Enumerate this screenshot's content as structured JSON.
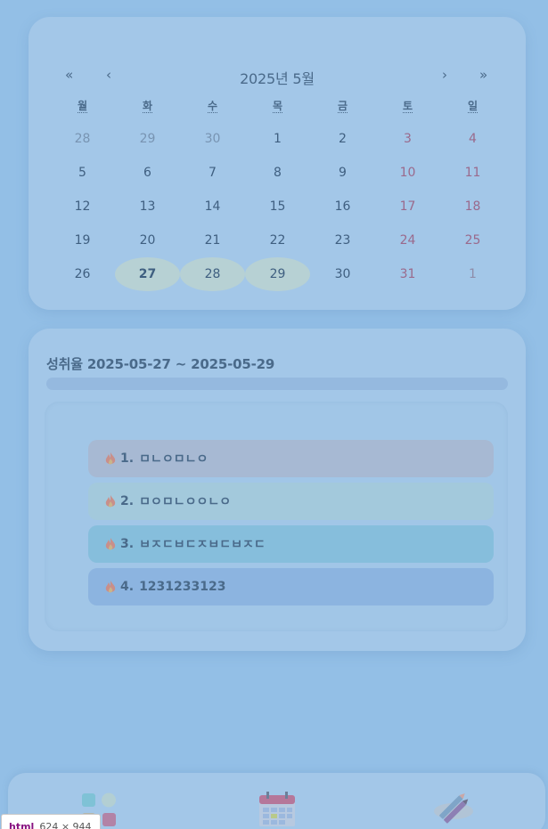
{
  "calendar": {
    "title": "2025년 5월",
    "nav": {
      "prev_year": "«",
      "prev_month": "‹",
      "next_month": "›",
      "next_year": "»"
    },
    "weekdays": [
      "월",
      "화",
      "수",
      "목",
      "금",
      "토",
      "일"
    ],
    "weeks": [
      [
        {
          "d": "28",
          "other": true
        },
        {
          "d": "29",
          "other": true
        },
        {
          "d": "30",
          "other": true
        },
        {
          "d": "1"
        },
        {
          "d": "2"
        },
        {
          "d": "3",
          "we": true
        },
        {
          "d": "4",
          "we": true
        }
      ],
      [
        {
          "d": "5"
        },
        {
          "d": "6"
        },
        {
          "d": "7"
        },
        {
          "d": "8"
        },
        {
          "d": "9"
        },
        {
          "d": "10",
          "we": true
        },
        {
          "d": "11",
          "we": true
        }
      ],
      [
        {
          "d": "12"
        },
        {
          "d": "13"
        },
        {
          "d": "14"
        },
        {
          "d": "15"
        },
        {
          "d": "16"
        },
        {
          "d": "17",
          "we": true
        },
        {
          "d": "18",
          "we": true
        }
      ],
      [
        {
          "d": "19"
        },
        {
          "d": "20"
        },
        {
          "d": "21"
        },
        {
          "d": "22"
        },
        {
          "d": "23"
        },
        {
          "d": "24",
          "we": true
        },
        {
          "d": "25",
          "we": true
        }
      ],
      [
        {
          "d": "26"
        },
        {
          "d": "27",
          "sel": true,
          "today": true
        },
        {
          "d": "28",
          "sel": true
        },
        {
          "d": "29",
          "sel": true
        },
        {
          "d": "30"
        },
        {
          "d": "31",
          "we": true
        },
        {
          "d": "1",
          "we": true,
          "other": true
        }
      ]
    ]
  },
  "rate": {
    "title": "성취율 2025-05-27 ~ 2025-05-29",
    "progress": 0
  },
  "goals": [
    {
      "num": "1.",
      "text": "ㅁㄴㅇㅁㄴㅇ",
      "color": "#a7b9d3"
    },
    {
      "num": "2.",
      "text": "ㅁㅇㅁㄴㅇㅇㄴㅇ",
      "color": "#a3c9dc"
    },
    {
      "num": "3.",
      "text": "ㅂㅈㄷㅂㄷㅈㅂㄷㅂㅈㄷ",
      "color": "#86bedc"
    },
    {
      "num": "4.",
      "text": "1231233123",
      "color": "#8cb4e0"
    }
  ],
  "bottom_nav": {
    "items": [
      {
        "icon": "grid-apps-icon"
      },
      {
        "icon": "calendar-icon"
      },
      {
        "icon": "pencil-icon"
      }
    ]
  },
  "devtools_tip": {
    "tag": "html",
    "size": "624 × 944"
  }
}
